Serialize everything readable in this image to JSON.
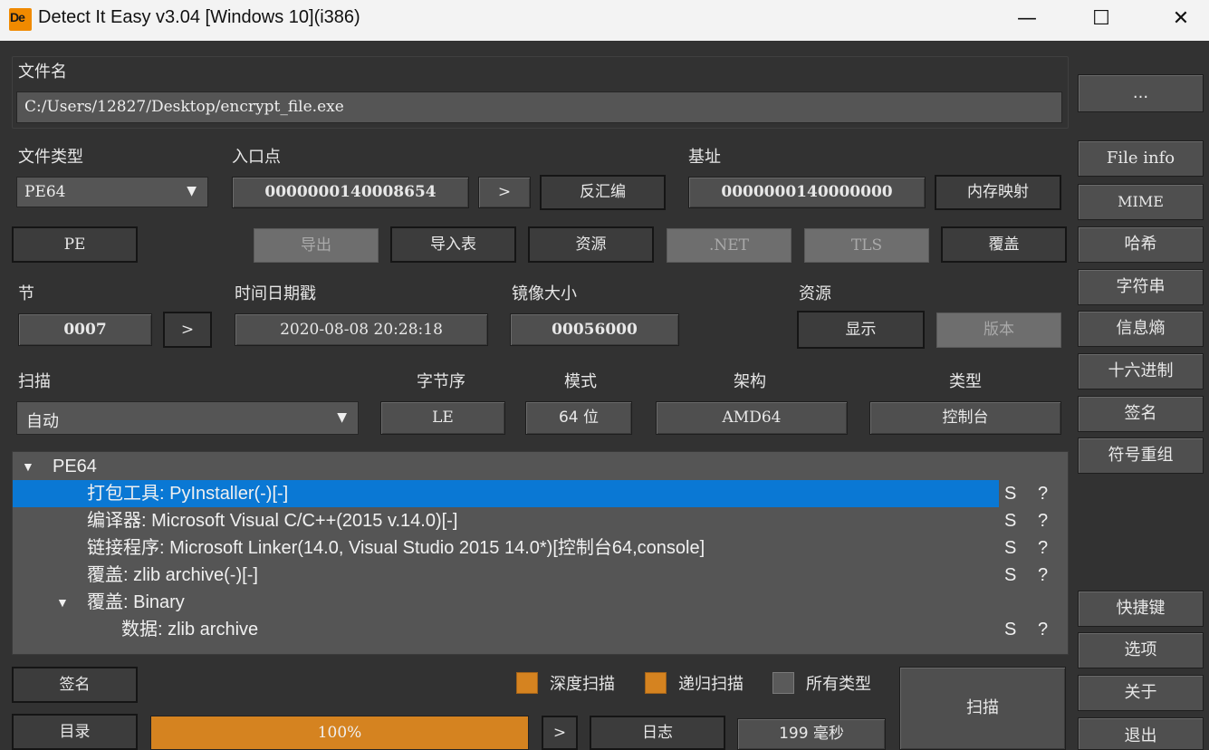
{
  "window": {
    "title": "Detect It Easy v3.04 [Windows 10](i386)",
    "logo": "De",
    "min": "—",
    "max": "☐",
    "close": "✕"
  },
  "file": {
    "label": "文件名",
    "path": "C:/Users/12827/Desktop/encrypt_file.exe",
    "browse": "..."
  },
  "filetype": {
    "label": "文件类型",
    "value": "PE64"
  },
  "entry": {
    "label": "入口点",
    "value": "0000000140008654",
    "go": ">",
    "disasm": "反汇编"
  },
  "base": {
    "label": "基址",
    "value": "0000000140000000",
    "memmap": "内存映射"
  },
  "buttons": {
    "pe": "PE",
    "export": "导出",
    "import": "导入表",
    "resources": "资源",
    "net": ".NET",
    "tls": "TLS",
    "overlay": "覆盖"
  },
  "section": {
    "label": "节",
    "value": "0007",
    "go": ">"
  },
  "timestamp": {
    "label": "时间日期戳",
    "value": "2020-08-08 20:28:18"
  },
  "imagesize": {
    "label": "镜像大小",
    "value": "00056000"
  },
  "res": {
    "label": "资源",
    "show": "显示",
    "version": "版本"
  },
  "scan": {
    "label": "扫描",
    "mode": "自动",
    "endian_label": "字节序",
    "endian": "LE",
    "mode_label": "模式",
    "bits": "64 位",
    "arch_label": "架构",
    "arch": "AMD64",
    "type_label": "类型",
    "type": "控制台"
  },
  "tree": {
    "root": "PE64",
    "rows": [
      {
        "text": "打包工具: PyInstaller(-)[-]",
        "s": "S",
        "q": "?"
      },
      {
        "text": "编译器: Microsoft Visual C/C++(2015 v.14.0)[-]",
        "s": "S",
        "q": "?"
      },
      {
        "text": "链接程序: Microsoft Linker(14.0, Visual Studio 2015 14.0*)[控制台64,console]",
        "s": "S",
        "q": "?"
      },
      {
        "text": "覆盖: zlib archive(-)[-]",
        "s": "S",
        "q": "?"
      },
      {
        "text": "覆盖: Binary"
      },
      {
        "text": "数据: zlib archive",
        "s": "S",
        "q": "?"
      }
    ]
  },
  "bottom": {
    "signature": "签名",
    "directory": "目录",
    "progress": "100%",
    "progress_value": 1.0,
    "go": ">",
    "log": "日志",
    "time": "199 毫秒",
    "deep_scan": "深度扫描",
    "recursive_scan": "递归扫描",
    "all_types": "所有类型",
    "scan": "扫描"
  },
  "right": {
    "file_info": "File info",
    "mime": "MIME",
    "hash": "哈希",
    "strings": "字符串",
    "entropy": "信息熵",
    "hex": "十六进制",
    "signature": "签名",
    "demangle": "符号重组",
    "shortcuts": "快捷键",
    "options": "选项",
    "about": "关于",
    "exit": "退出"
  },
  "colors": {
    "accent": "#d58320",
    "selection": "#0a78d4",
    "background": "#323232"
  }
}
